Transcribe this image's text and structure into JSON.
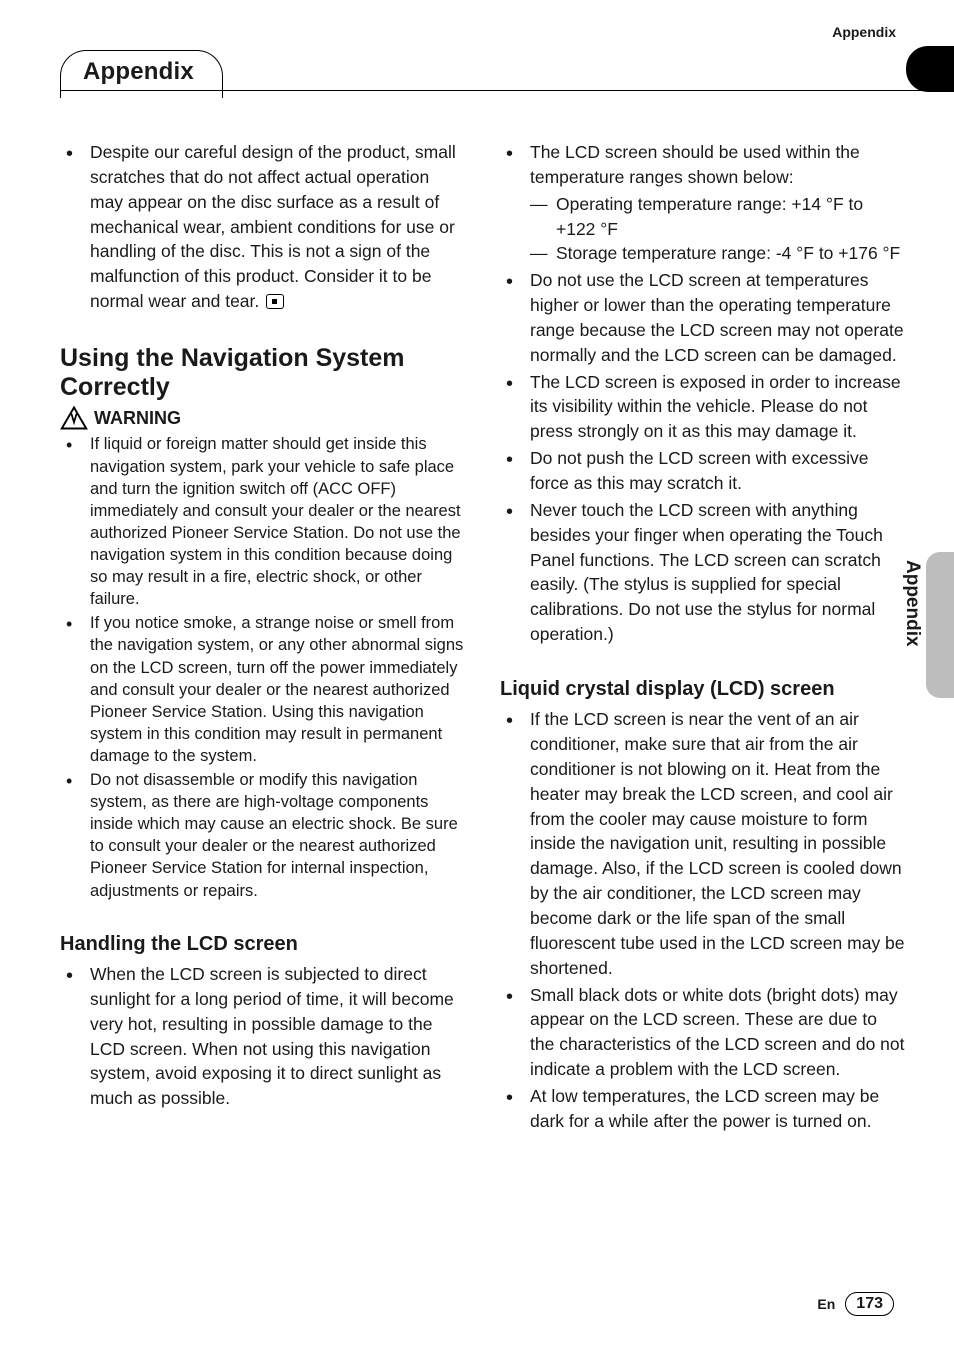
{
  "header": {
    "top_label": "Appendix",
    "chapter_title": "Appendix"
  },
  "side_tab": "Appendix",
  "footer": {
    "lang": "En",
    "page": "173"
  },
  "left": {
    "intro_bullet": "Despite our careful design of the product, small scratches that do not affect actual operation may appear on the disc surface as a result of mechanical wear, ambient conditions for use or handling of the disc. This is not a sign of the malfunction of this product. Consider it to be normal wear and tear.",
    "section_heading": "Using the Navigation System Correctly",
    "warning_label": "WARNING",
    "warnings": [
      "If liquid or foreign matter should get inside this navigation system, park your vehicle to safe place and turn the ignition switch off (ACC OFF) immediately and consult your dealer or the nearest authorized Pioneer Service Station. Do not use the navigation system in this condition because doing so may result in a fire, electric shock, or other failure.",
      "If you notice smoke, a strange noise or smell from the navigation system, or any other abnormal signs on the LCD screen, turn off the power immediately and consult your dealer or the nearest authorized Pioneer Service Station. Using this navigation system in this condition may result in permanent damage to the system.",
      "Do not disassemble or modify this navigation system, as there are high-voltage components inside which may cause an electric shock. Be sure to consult your dealer or the nearest authorized Pioneer Service Station for internal inspection, adjustments or repairs."
    ],
    "handling_heading": "Handling the LCD screen",
    "handling_bullets": [
      "When the LCD screen is subjected to direct sunlight for a long period of time, it will become very hot, resulting in possible damage to the LCD screen. When not using this navigation system, avoid exposing it to direct sunlight as much as possible."
    ]
  },
  "right": {
    "temp_intro": "The LCD screen should be used within the temperature ranges shown below:",
    "temp_sub": [
      "Operating temperature range: +14 °F to +122 °F",
      "Storage temperature range: -4 °F to +176 °F"
    ],
    "bullets_after_temp": [
      "Do not use the LCD screen at temperatures higher or lower than the operating temperature range because the LCD screen may not operate normally and the LCD screen can be damaged.",
      "The LCD screen is exposed in order to increase its visibility within the vehicle. Please do not press strongly on it as this may damage it.",
      "Do not push the LCD screen with excessive force as this may scratch it.",
      "Never touch the LCD screen with anything besides your finger when operating the Touch Panel functions. The LCD screen can scratch easily. (The stylus is supplied for special calibrations. Do not use the stylus for normal operation.)"
    ],
    "lcd_heading": "Liquid crystal display (LCD) screen",
    "lcd_bullets": [
      "If the LCD screen is near the vent of an air conditioner, make sure that air from the air conditioner is not blowing on it. Heat from the heater may break the LCD screen, and cool air from the cooler may cause moisture to form inside the navigation unit, resulting in possible damage. Also, if the LCD screen is cooled down by the air conditioner, the LCD screen may become dark or the life span of the small fluorescent tube used in the LCD screen may be shortened.",
      "Small black dots or white dots (bright dots) may appear on the LCD screen. These are due to the characteristics of the LCD screen and do not indicate a problem with the LCD screen.",
      "At low temperatures, the LCD screen may be dark for a while after the power is turned on."
    ]
  }
}
